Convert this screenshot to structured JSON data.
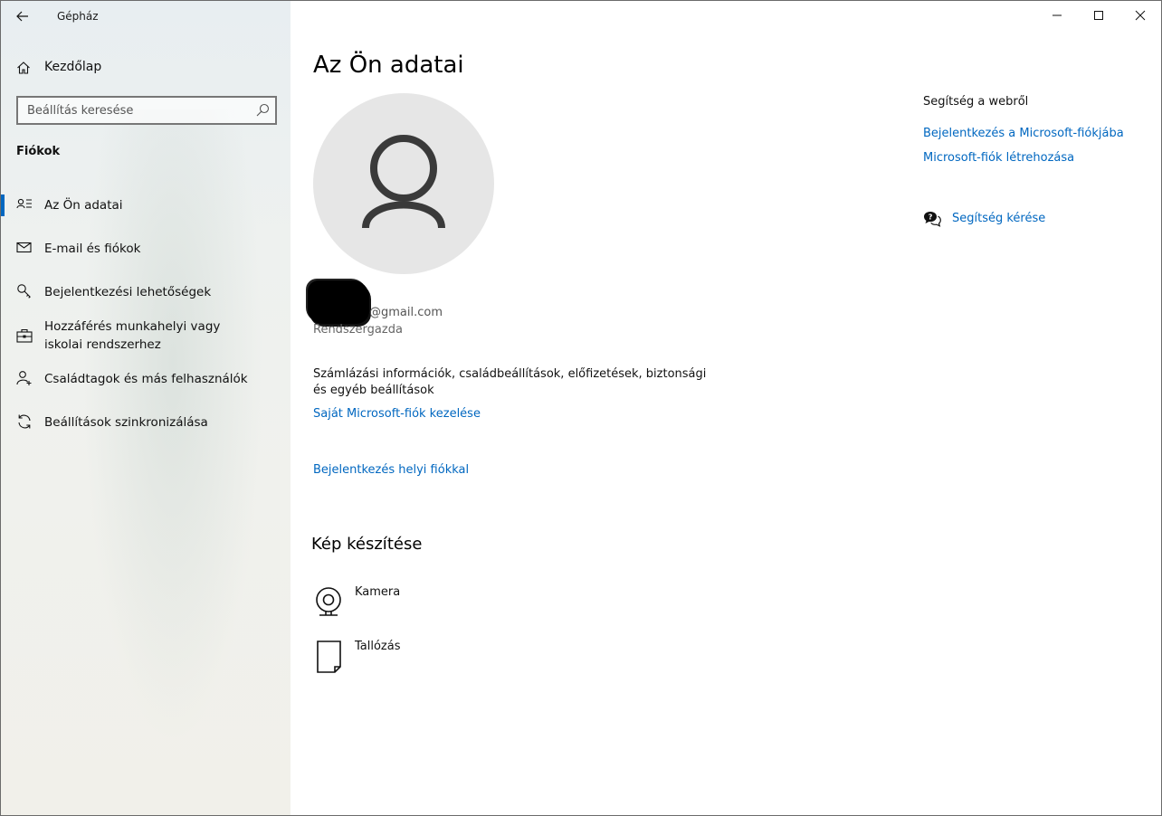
{
  "window": {
    "title": "Gépház"
  },
  "sidebar": {
    "home_label": "Kezdőlap",
    "search_placeholder": "Beállítás keresése",
    "section": "Fiókok",
    "items": [
      {
        "label": "Az Ön adatai",
        "icon": "person-list-icon",
        "active": true
      },
      {
        "label": "E-mail és fiókok",
        "icon": "mail-icon",
        "active": false
      },
      {
        "label": "Bejelentkezési lehetőségek",
        "icon": "key-icon",
        "active": false
      },
      {
        "label": "Hozzáférés munkahelyi vagy iskolai rendszerhez",
        "icon": "briefcase-icon",
        "active": false
      },
      {
        "label": "Családtagok és más felhasználók",
        "icon": "add-person-icon",
        "active": false
      },
      {
        "label": "Beállítások szinkronizálása",
        "icon": "sync-icon",
        "active": false
      }
    ]
  },
  "main": {
    "title": "Az Ön adatai",
    "email": "@gmail.com",
    "role": "Rendszergazda",
    "description": "Számlázási információk, családbeállítások, előfizetések, biztonsági és egyéb beállítások",
    "manage_link": "Saját Microsoft-fiók kezelése",
    "local_link": "Bejelentkezés helyi fiókkal",
    "picture_title": "Kép készítése",
    "camera_label": "Kamera",
    "browse_label": "Tallózás"
  },
  "help": {
    "heading": "Segítség a webről",
    "links": [
      "Bejelentkezés a Microsoft-fiókjába",
      "Microsoft-fiók létrehozása"
    ],
    "get_help": "Segítség kérése"
  },
  "colors": {
    "accent": "#0067c0",
    "avatar_bg": "#e6e6e6"
  }
}
